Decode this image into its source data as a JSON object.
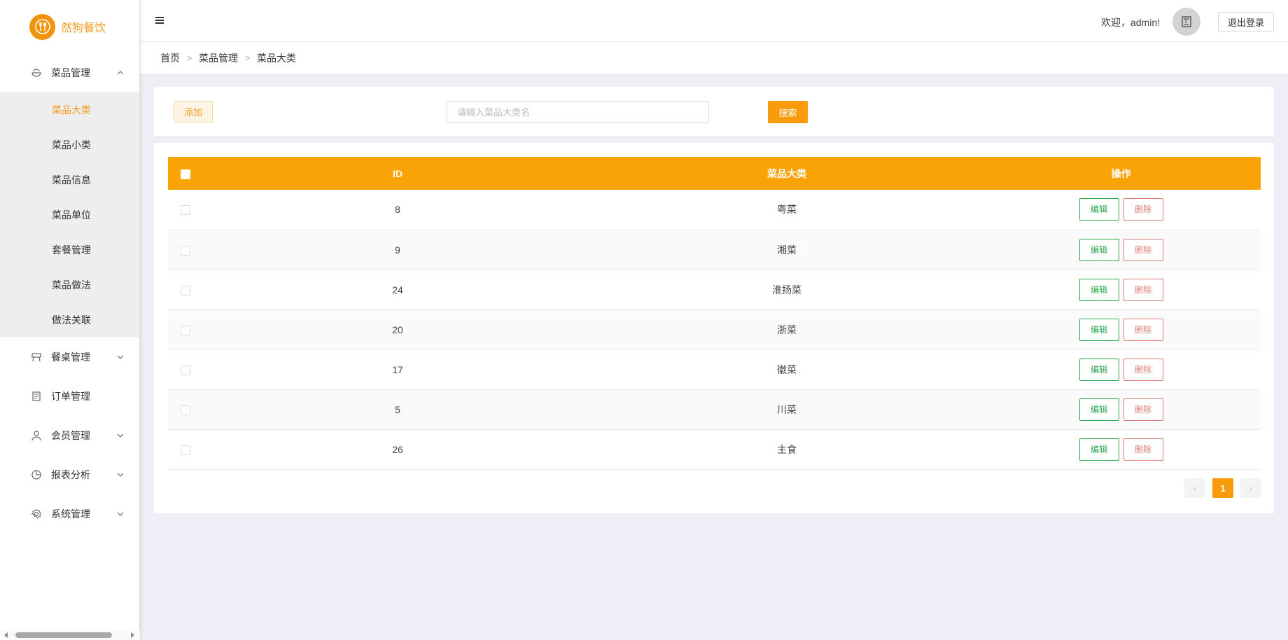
{
  "app": {
    "name": "然狗餐饮"
  },
  "header": {
    "welcome": "欢迎，admin!",
    "logout_label": "退出登录"
  },
  "sidebar": {
    "menus": [
      {
        "label": "菜品管理",
        "icon": "bowl-icon",
        "expanded": true
      },
      {
        "label": "餐桌管理",
        "icon": "table-icon"
      },
      {
        "label": "订单管理",
        "icon": "order-icon"
      },
      {
        "label": "会员管理",
        "icon": "user-icon"
      },
      {
        "label": "报表分析",
        "icon": "pie-chart-icon"
      },
      {
        "label": "系统管理",
        "icon": "gear-icon"
      }
    ],
    "submenu": [
      {
        "label": "菜品大类",
        "active": true
      },
      {
        "label": "菜品小类"
      },
      {
        "label": "菜品信息"
      },
      {
        "label": "菜品单位"
      },
      {
        "label": "套餐管理"
      },
      {
        "label": "菜品做法"
      },
      {
        "label": "做法关联"
      }
    ]
  },
  "breadcrumb": [
    "首页",
    "菜品管理",
    "菜品大类"
  ],
  "search": {
    "add_label": "添加",
    "placeholder": "请输入菜品大类名",
    "value": "",
    "button_label": "搜索"
  },
  "table": {
    "columns": [
      "ID",
      "菜品大类",
      "操作"
    ],
    "edit_label": "编辑",
    "delete_label": "删除",
    "rows": [
      {
        "id": "8",
        "name": "粤菜"
      },
      {
        "id": "9",
        "name": "湘菜"
      },
      {
        "id": "24",
        "name": "淮扬菜"
      },
      {
        "id": "20",
        "name": "浙菜"
      },
      {
        "id": "17",
        "name": "徽菜"
      },
      {
        "id": "5",
        "name": "川菜"
      },
      {
        "id": "26",
        "name": "主食"
      }
    ]
  },
  "pagination": {
    "current": "1",
    "prev": "‹",
    "next": "›"
  },
  "colors": {
    "accent": "#faa306",
    "brand": "#f29a1c",
    "edit": "#2fa84f",
    "delete": "#e07b7b"
  }
}
